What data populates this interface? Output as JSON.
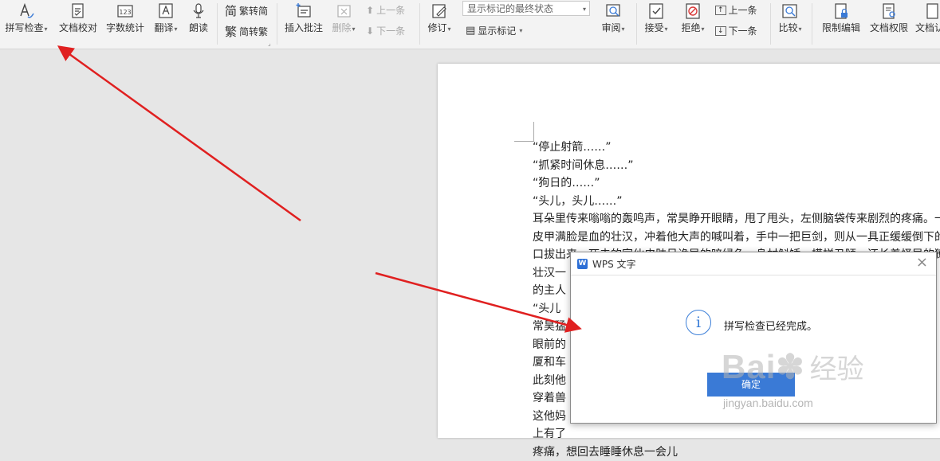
{
  "ribbon": {
    "spell_check": "拼写检查",
    "doc_proof": "文档校对",
    "word_count": "字数统计",
    "translate": "翻译",
    "read_aloud": "朗读",
    "trad_to_simp": "繁转简",
    "simp_to_trad": "简转繁",
    "insert_comment": "插入批注",
    "delete": "删除",
    "prev_item": "上一条",
    "next_item": "下一条",
    "revise": "修订",
    "display_mode_value": "显示标记的最终状态",
    "show_markup": "显示标记",
    "review": "审阅",
    "accept": "接受",
    "reject": "拒绝",
    "prev_change": "上一条",
    "next_change": "下一条",
    "compare": "比较",
    "restrict_edit": "限制编辑",
    "doc_permission": "文档权限",
    "doc_more": "文档认"
  },
  "document": {
    "lines": [
      "“停止射箭……”",
      "“抓紧时间休息……”",
      "“狗日的……”",
      "“头儿，头儿……”",
      "耳朵里传来嗡嗡的轰鸣声，常昊睁开眼睛，甩了甩头，左侧脑袋传来剧烈的疼痛。一",
      "皮甲满脸是血的壮汉，冲着他大声的喊叫着，手中一把巨剑，则从一具正缓缓倒下的",
      "口拔出来，死去的家伙皮肤呈诡异的暗绿色，身材斛矮，模样丑陋，还长着怪异的獠",
      "壮汉一",
      "的主人",
      "“头儿",
      "常昊猛",
      "眼前的",
      "厦和车",
      "此刻他",
      "穿着兽",
      "这他妈",
      "上有了",
      "疼痛，想回去睡睡休息一会儿"
    ]
  },
  "dialog": {
    "title": "WPS 文字",
    "message": "拼写检查已经完成。",
    "ok": "确定"
  },
  "watermark": {
    "brand": "Bai",
    "brand2": "经验",
    "url": "jingyan.baidu.com"
  },
  "colors": {
    "arrow": "#e02020",
    "accent": "#3a7ad6"
  }
}
